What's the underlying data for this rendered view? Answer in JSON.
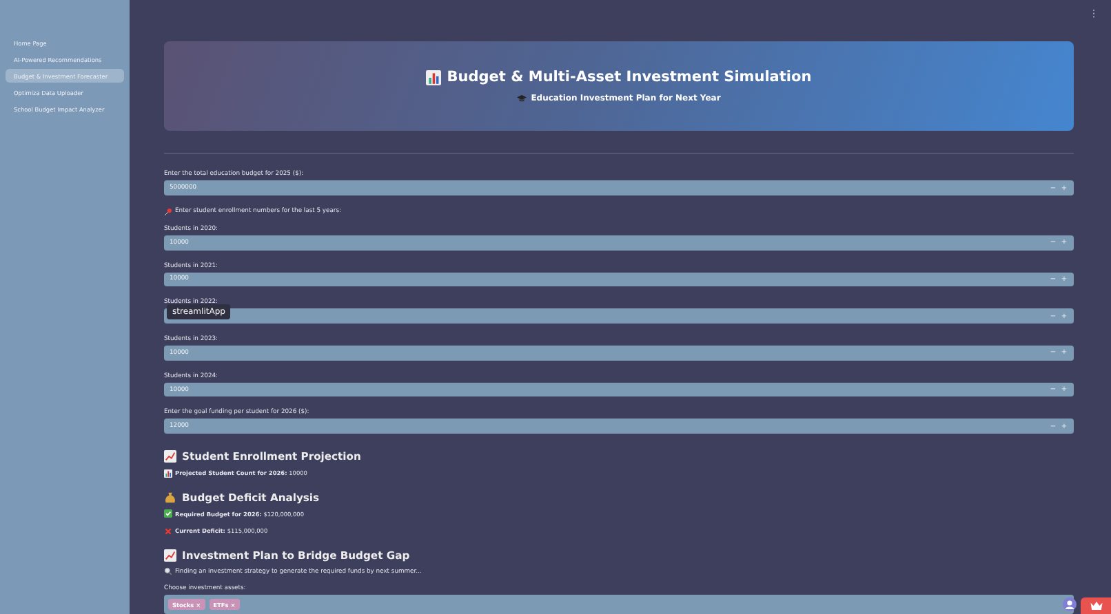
{
  "sidebar": {
    "items": [
      {
        "label": "Home Page",
        "selected": false
      },
      {
        "label": "AI-Powered Recommendations",
        "selected": false
      },
      {
        "label": "Budget & Investment Forecaster",
        "selected": true
      },
      {
        "label": "Optimiza Data Uploader",
        "selected": false
      },
      {
        "label": "School Budget Impact Analyzer",
        "selected": false
      }
    ]
  },
  "menu_glyph": "⋮",
  "banner": {
    "title": "Budget & Multi-Asset Investment Simulation",
    "subtitle": "Education Investment Plan for Next Year"
  },
  "stepper": [
    "−",
    "+"
  ],
  "content": [
    {
      "kind": "field",
      "label": "Enter the total education budget for 2025 ($):",
      "value": "5000000"
    },
    {
      "kind": "note",
      "text": "Enter student enrollment numbers for the last 5 years:"
    },
    {
      "kind": "field",
      "label": "Students in 2020:",
      "value": "10000"
    },
    {
      "kind": "field",
      "label": "Students in 2021:",
      "value": "10000"
    },
    {
      "kind": "field",
      "label": "Students in 2022:",
      "tooltip": "streamlitApp"
    },
    {
      "kind": "field",
      "label": "Students in 2023:",
      "value": "10000"
    },
    {
      "kind": "field",
      "label": "Students in 2024:",
      "value": "10000"
    },
    {
      "kind": "field",
      "label": "Enter the goal funding per student for 2026 ($):",
      "value": "12000"
    },
    {
      "kind": "heading",
      "text": "Student Enrollment Projection"
    },
    {
      "kind": "stat",
      "label": "Projected Student Count for 2026:",
      "value": "10000"
    },
    {
      "kind": "heading",
      "text": "Budget Deficit Analysis"
    },
    {
      "kind": "stat",
      "label": "Required Budget for 2026:",
      "value": "$120,000,000"
    },
    {
      "kind": "stat",
      "label": "Current Deficit:",
      "value": "$115,000,000"
    },
    {
      "kind": "heading",
      "text": "Investment Plan to Bridge Budget Gap"
    },
    {
      "kind": "note",
      "text": "Finding an investment strategy to generate the required funds by next summer..."
    },
    {
      "kind": "multiselect",
      "label": "Choose investment assets:",
      "tags": [
        "Stocks",
        "ETFs"
      ],
      "remove_glyph": "×"
    }
  ]
}
